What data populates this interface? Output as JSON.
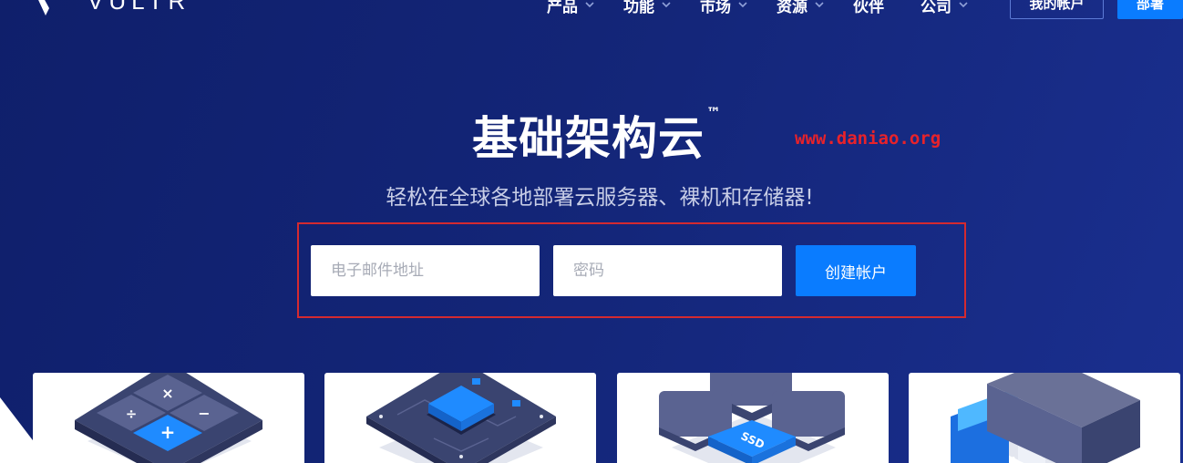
{
  "header": {
    "logo_text": "VULTR",
    "nav": [
      {
        "label": "产品"
      },
      {
        "label": "功能"
      },
      {
        "label": "市场"
      },
      {
        "label": "资源"
      },
      {
        "label": "伙伴"
      },
      {
        "label": "公司"
      }
    ],
    "login_label": "我的帐户",
    "deploy_label": "部署"
  },
  "hero": {
    "title": "基础架构云",
    "trademark": "™",
    "watermark": "www.daniao.org",
    "subtitle": "轻松在全球各地部署云服务器、裸机和存储器!"
  },
  "signup": {
    "email_placeholder": "电子邮件地址",
    "password_placeholder": "密码",
    "submit_label": "创建帐户"
  },
  "cards": [
    {
      "icon": "calculator-icon",
      "symbols": [
        "×",
        "÷",
        "−",
        "+"
      ]
    },
    {
      "icon": "chip-icon"
    },
    {
      "icon": "ssd-icon",
      "badge": "SSD"
    },
    {
      "icon": "storage-icon"
    }
  ],
  "colors": {
    "background": "#132577",
    "accent": "#0a7cff",
    "highlight_frame": "#d42a30",
    "watermark": "#e8222a"
  }
}
